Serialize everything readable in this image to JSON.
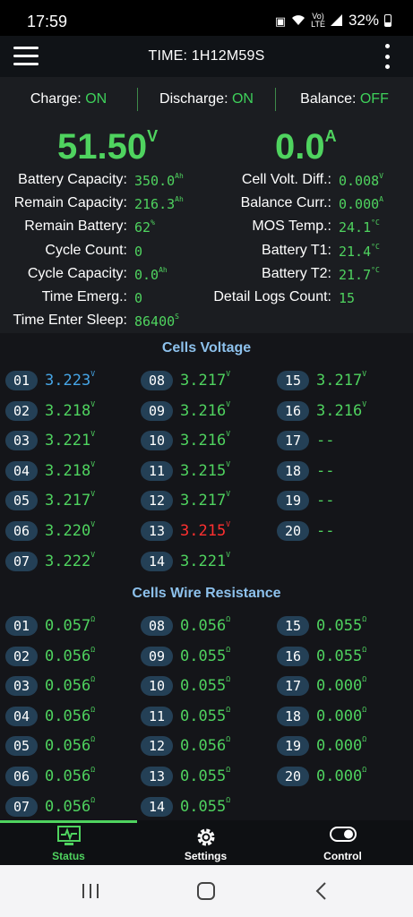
{
  "status_bar": {
    "time": "17:59",
    "lte_top": "Vo)",
    "lte_bottom": "LTE",
    "battery": "32%"
  },
  "app_bar": {
    "title": "TIME: 1H12M59S"
  },
  "modes": [
    {
      "label": "Charge:",
      "value": "ON"
    },
    {
      "label": "Discharge:",
      "value": "ON"
    },
    {
      "label": "Balance:",
      "value": "OFF"
    }
  ],
  "totals": {
    "voltage": "51.50",
    "voltage_unit": "V",
    "current": "0.0",
    "current_unit": "A"
  },
  "left_info": [
    {
      "label": "Battery Capacity:",
      "value": "350.0",
      "unit": "Ah"
    },
    {
      "label": "Remain Capacity:",
      "value": "216.3",
      "unit": "Ah"
    },
    {
      "label": "Remain Battery:",
      "value": "62",
      "unit": "%"
    },
    {
      "label": "Cycle Count:",
      "value": "0",
      "unit": ""
    },
    {
      "label": "Cycle Capacity:",
      "value": "0.0",
      "unit": "Ah"
    },
    {
      "label": "Time Emerg.:",
      "value": "0",
      "unit": ""
    },
    {
      "label": "Time Enter Sleep:",
      "value": "86400",
      "unit": "S"
    }
  ],
  "right_info": [
    {
      "label": "Cell Volt. Diff.:",
      "value": "0.008",
      "unit": "V"
    },
    {
      "label": "Balance Curr.:",
      "value": "0.000",
      "unit": "A"
    },
    {
      "label": "MOS Temp.:",
      "value": "24.1",
      "unit": "°C"
    },
    {
      "label": "Battery T1:",
      "value": "21.4",
      "unit": "°C"
    },
    {
      "label": "Battery T2:",
      "value": "21.7",
      "unit": "°C"
    },
    {
      "label": "Detail Logs Count:",
      "value": "15",
      "unit": ""
    }
  ],
  "cells_voltage": {
    "title": "Cells Voltage",
    "cells": [
      {
        "num": "01",
        "value": "3.223",
        "unit": "V",
        "style": "blue"
      },
      {
        "num": "02",
        "value": "3.218",
        "unit": "V",
        "style": ""
      },
      {
        "num": "03",
        "value": "3.221",
        "unit": "V",
        "style": ""
      },
      {
        "num": "04",
        "value": "3.218",
        "unit": "V",
        "style": ""
      },
      {
        "num": "05",
        "value": "3.217",
        "unit": "V",
        "style": ""
      },
      {
        "num": "06",
        "value": "3.220",
        "unit": "V",
        "style": ""
      },
      {
        "num": "07",
        "value": "3.222",
        "unit": "V",
        "style": ""
      },
      {
        "num": "08",
        "value": "3.217",
        "unit": "V",
        "style": ""
      },
      {
        "num": "09",
        "value": "3.216",
        "unit": "V",
        "style": ""
      },
      {
        "num": "10",
        "value": "3.216",
        "unit": "V",
        "style": ""
      },
      {
        "num": "11",
        "value": "3.215",
        "unit": "V",
        "style": ""
      },
      {
        "num": "12",
        "value": "3.217",
        "unit": "V",
        "style": ""
      },
      {
        "num": "13",
        "value": "3.215",
        "unit": "V",
        "style": "red"
      },
      {
        "num": "14",
        "value": "3.221",
        "unit": "V",
        "style": ""
      },
      {
        "num": "15",
        "value": "3.217",
        "unit": "V",
        "style": ""
      },
      {
        "num": "16",
        "value": "3.216",
        "unit": "V",
        "style": ""
      },
      {
        "num": "17",
        "value": "--",
        "unit": "",
        "style": ""
      },
      {
        "num": "18",
        "value": "--",
        "unit": "",
        "style": ""
      },
      {
        "num": "19",
        "value": "--",
        "unit": "",
        "style": ""
      },
      {
        "num": "20",
        "value": "--",
        "unit": "",
        "style": ""
      }
    ]
  },
  "cells_resistance": {
    "title": "Cells Wire Resistance",
    "cells": [
      {
        "num": "01",
        "value": "0.057",
        "unit": "Ω"
      },
      {
        "num": "02",
        "value": "0.056",
        "unit": "Ω"
      },
      {
        "num": "03",
        "value": "0.056",
        "unit": "Ω"
      },
      {
        "num": "04",
        "value": "0.056",
        "unit": "Ω"
      },
      {
        "num": "05",
        "value": "0.056",
        "unit": "Ω"
      },
      {
        "num": "06",
        "value": "0.056",
        "unit": "Ω"
      },
      {
        "num": "07",
        "value": "0.056",
        "unit": "Ω"
      },
      {
        "num": "08",
        "value": "0.056",
        "unit": "Ω"
      },
      {
        "num": "09",
        "value": "0.055",
        "unit": "Ω"
      },
      {
        "num": "10",
        "value": "0.055",
        "unit": "Ω"
      },
      {
        "num": "11",
        "value": "0.055",
        "unit": "Ω"
      },
      {
        "num": "12",
        "value": "0.056",
        "unit": "Ω"
      },
      {
        "num": "13",
        "value": "0.055",
        "unit": "Ω"
      },
      {
        "num": "14",
        "value": "0.055",
        "unit": "Ω"
      },
      {
        "num": "15",
        "value": "0.055",
        "unit": "Ω"
      },
      {
        "num": "16",
        "value": "0.055",
        "unit": "Ω"
      },
      {
        "num": "17",
        "value": "0.000",
        "unit": "Ω"
      },
      {
        "num": "18",
        "value": "0.000",
        "unit": "Ω"
      },
      {
        "num": "19",
        "value": "0.000",
        "unit": "Ω"
      },
      {
        "num": "20",
        "value": "0.000",
        "unit": "Ω"
      }
    ]
  },
  "bottom_nav": [
    {
      "label": "Status",
      "icon": "monitor-pulse-icon",
      "active": true
    },
    {
      "label": "Settings",
      "icon": "gear-icon",
      "active": false
    },
    {
      "label": "Control",
      "icon": "toggle-icon",
      "active": false
    }
  ],
  "colors": {
    "accent_green": "#4fd35f",
    "cell_badge": "#244056",
    "section_title": "#8dc1ec",
    "alert_red": "#ff3030",
    "highlight_blue": "#46a5e6"
  }
}
